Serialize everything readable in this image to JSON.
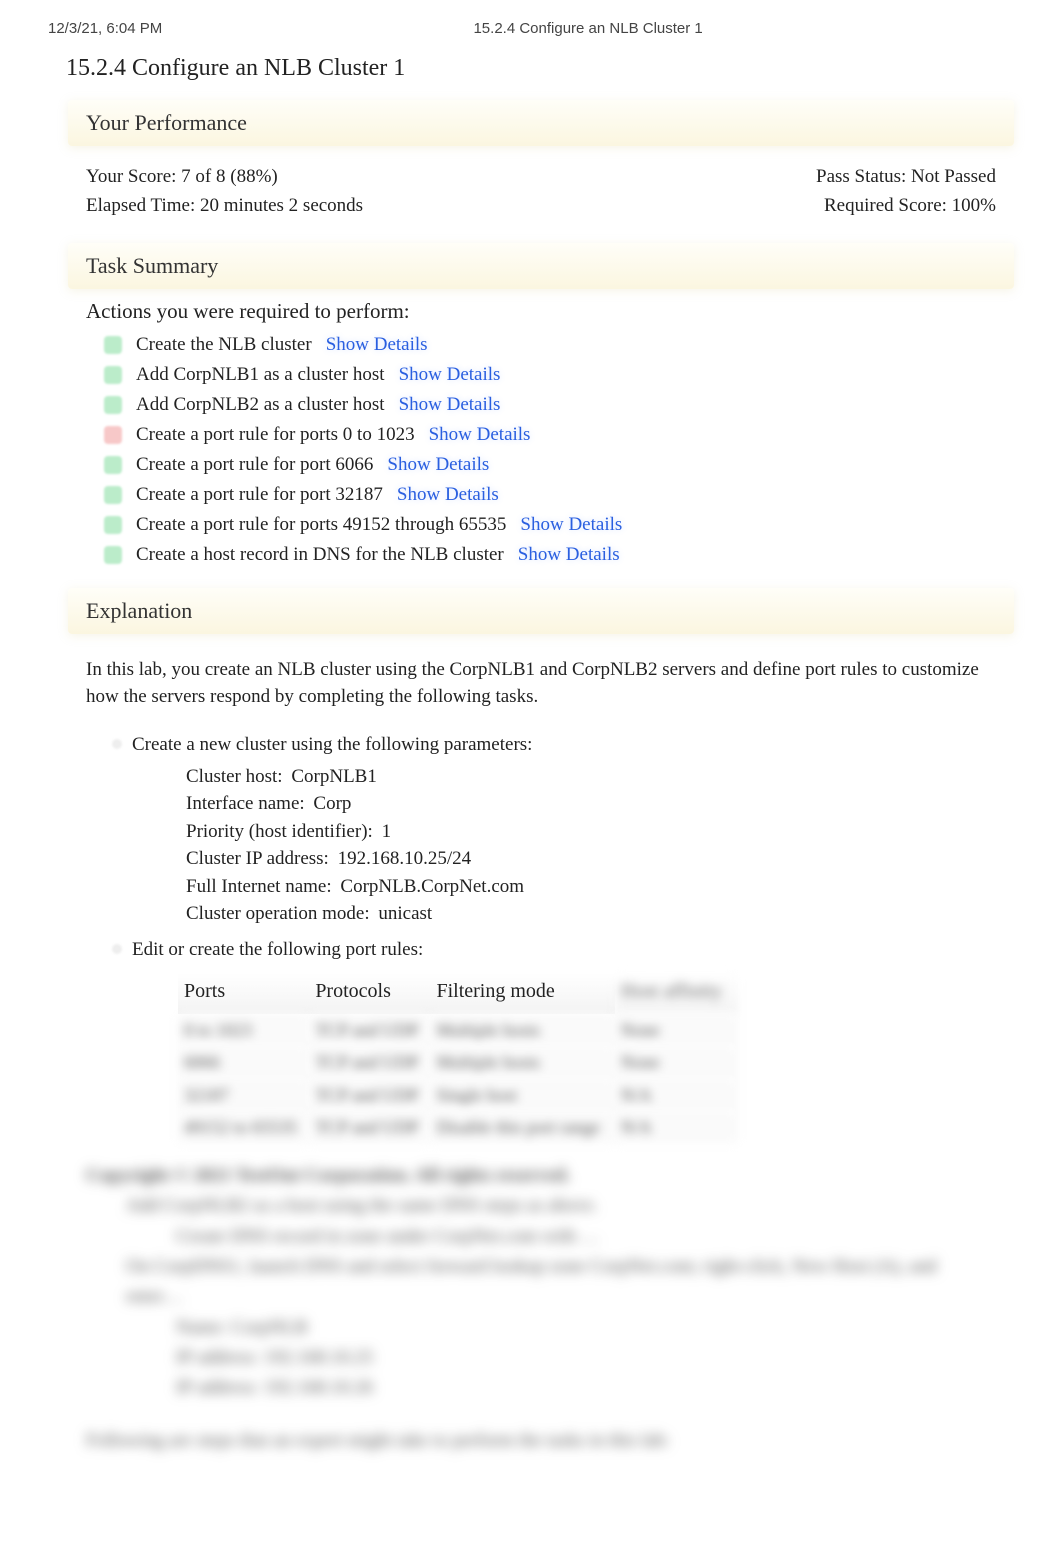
{
  "page_header": {
    "timestamp": "12/3/21, 6:04 PM",
    "center_title": "15.2.4 Configure an NLB Cluster 1"
  },
  "main_title": "15.2.4 Configure an NLB Cluster 1",
  "performance": {
    "heading": "Your Performance",
    "score_line": "Your Score: 7 of 8 (88%)",
    "elapsed_line": "Elapsed Time: 20 minutes 2 seconds",
    "pass_line": "Pass Status: Not Passed",
    "required_line": "Required Score: 100%"
  },
  "task_summary": {
    "heading": "Task Summary",
    "subheading": "Actions you were required to perform:",
    "show_details_label": "Show Details",
    "items": [
      {
        "status": "ok",
        "text": "Create the NLB cluster"
      },
      {
        "status": "ok",
        "text": "Add CorpNLB1 as a cluster host"
      },
      {
        "status": "ok",
        "text": "Add CorpNLB2 as a cluster host"
      },
      {
        "status": "fail",
        "text": "Create a port rule for ports 0 to 1023"
      },
      {
        "status": "ok",
        "text": "Create a port rule for port 6066"
      },
      {
        "status": "ok",
        "text": "Create a port rule for port 32187"
      },
      {
        "status": "ok",
        "text": "Create a port rule for ports 49152 through 65535"
      },
      {
        "status": "ok",
        "text": "Create a host record in DNS for the NLB cluster"
      }
    ]
  },
  "explanation": {
    "heading": "Explanation",
    "intro": "In this lab, you create an NLB cluster using the CorpNLB1 and CorpNLB2 servers and define port rules to customize how the servers respond by completing the following tasks.",
    "step_cluster": "Create a new cluster using the following parameters:",
    "params": [
      {
        "label": "Cluster host:",
        "value": "CorpNLB1"
      },
      {
        "label": "Interface name:",
        "value": "Corp"
      },
      {
        "label": "Priority (host identifier):",
        "value": "1"
      },
      {
        "label": "Cluster IP address:",
        "value": "192.168.10.25/24"
      },
      {
        "label": "Full Internet name:",
        "value": "CorpNLB.CorpNet.com"
      },
      {
        "label": "Cluster operation mode:",
        "value": "unicast"
      }
    ],
    "step_rules": "Edit or create the following port rules:",
    "table": {
      "headers": [
        "Ports",
        "Protocols",
        "Filtering mode",
        "Host affinity"
      ],
      "rows": [
        [
          "0 to 1023",
          "TCP and UDP",
          "Multiple hosts",
          "None"
        ],
        [
          "6066",
          "TCP and UDP",
          "Multiple hosts",
          "None"
        ],
        [
          "32187",
          "TCP and UDP",
          "Single host",
          "N/A"
        ],
        [
          "49152 to 65535",
          "TCP and UDP",
          "Disable this port range",
          "N/A"
        ]
      ]
    }
  },
  "obscured": {
    "line_bold": "Copyright © 2021 TestOut Corporation. All rights reserved.",
    "line_a": "Add CorpNLB2 as a host using the same DNS steps as above.",
    "line_b": "Create DNS record in zone under CorpNet.com with …",
    "line_c": "On CorpDNS1, launch DNS and select forward lookup zone CorpNet.com; right-click, New Host (A), and enter…",
    "line_d": "Name: CorpNLB",
    "line_e": "IP address: 192.168.10.25",
    "line_f": "IP address: 192.168.10.26",
    "line_g": "Following are steps that an expert might take to perform the tasks in this lab:"
  }
}
